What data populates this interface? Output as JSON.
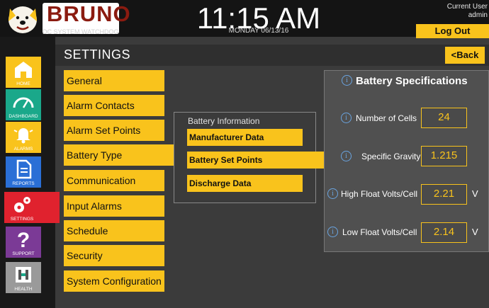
{
  "header": {
    "brand_name": "BRUNO",
    "brand_sub": "DC SYSTEM WATCHDOG",
    "time": "11:15 AM",
    "date": "MONDAY 06/13/16",
    "current_user_label": "Current User",
    "current_user_name": "admin",
    "logout_label": "Log Out"
  },
  "sidebar": {
    "items": [
      {
        "label": "HOME",
        "icon": "home-icon",
        "color": "#f9c31c"
      },
      {
        "label": "DASHBOARD",
        "icon": "gauge-icon",
        "color": "#1aa88a"
      },
      {
        "label": "ALARMS",
        "icon": "bell-icon",
        "color": "#f9c31c"
      },
      {
        "label": "REPORTS",
        "icon": "document-icon",
        "color": "#2a6fd6"
      },
      {
        "label": "SETTINGS",
        "icon": "gears-icon",
        "color": "#e0222e"
      },
      {
        "label": "SUPPORT",
        "icon": "question-icon",
        "color": "#7b3a96"
      },
      {
        "label": "HEALTH",
        "icon": "health-icon",
        "color": "#9a9a9a"
      }
    ]
  },
  "page": {
    "title": "SETTINGS",
    "back_label": "<Back"
  },
  "menu": {
    "items": [
      "General",
      "Alarm Contacts",
      "Alarm Set Points",
      "Battery Type",
      "Communication",
      "Input Alarms",
      "Schedule",
      "Security",
      "System Configuration"
    ]
  },
  "battery_info": {
    "title": "Battery Information",
    "buttons": [
      "Manufacturer Data",
      "Battery Set Points",
      "Discharge Data"
    ]
  },
  "spec": {
    "title": "Battery Specifications",
    "rows": [
      {
        "label": "Number of Cells",
        "value": "24",
        "unit": ""
      },
      {
        "label": "Specific Gravity",
        "value": "1.215",
        "unit": ""
      },
      {
        "label": "High Float Volts/Cell",
        "value": "2.21",
        "unit": "V"
      },
      {
        "label": "Low Float Volts/Cell",
        "value": "2.14",
        "unit": "V"
      }
    ]
  },
  "colors": {
    "accent": "#f9c31c",
    "info": "#6aa4e0",
    "brand": "#8b1b10"
  }
}
